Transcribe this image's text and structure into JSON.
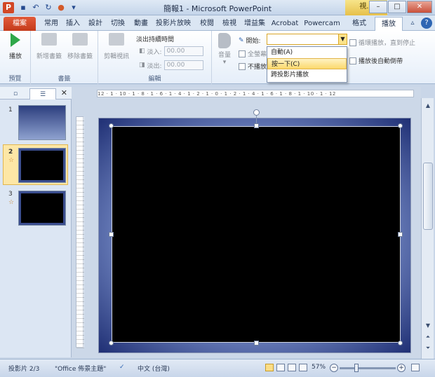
{
  "app": {
    "title": "簡報1 - Microsoft PowerPoint",
    "context_tab_group": "視...",
    "quick_access": [
      "save-icon",
      "undo-icon",
      "redo-icon",
      "record-icon",
      "customize-icon"
    ]
  },
  "tabs": [
    "檔案",
    "常用",
    "插入",
    "設計",
    "切換",
    "動畫",
    "投影片放映",
    "校閱",
    "檢視",
    "增益集",
    "Acrobat",
    "Powercam",
    "格式",
    "播放"
  ],
  "active_tab": "播放",
  "ribbon": {
    "preview": {
      "label": "預覽",
      "play": "播放"
    },
    "bookmarks": {
      "label": "書籤",
      "add": "新增書籤",
      "remove": "移除書籤"
    },
    "editing": {
      "label": "編輯",
      "trim": "剪輯視訊",
      "fade_duration": "淡出持續時間",
      "fade_in_label": "淡入:",
      "fade_in_value": "00.00",
      "fade_out_label": "淡出:",
      "fade_out_value": "00.00"
    },
    "video_options": {
      "volume": "音量",
      "start_label": "開始:",
      "start_value": "",
      "fullscreen": "全螢幕",
      "hide": "不播放時隱藏",
      "loop": "循環播放，直到停止",
      "rewind": "播放後自動倒帶"
    }
  },
  "start_menu": {
    "items": [
      "自動(A)",
      "按一下(C)",
      "跨投影片播放"
    ],
    "selected_index": 1
  },
  "slides_pane": {
    "slides": [
      {
        "number": "1",
        "star": ""
      },
      {
        "number": "2",
        "star": "☆"
      },
      {
        "number": "3",
        "star": "☆"
      }
    ],
    "selected": 2
  },
  "ruler": {
    "horizontal": "12 · 1 · 10 · 1 · 8 · 1 · 6 · 1 · 4 · 1 · 2 · 1 · 0 · 1 · 2 · 1 · 4 · 1 · 6 · 1 · 8 · 1 · 10 · 1 · 12"
  },
  "status": {
    "slide_info": "投影片 2/3",
    "theme": "\"Office 佈景主題\"",
    "language": "中文 (台灣)",
    "zoom": "57%"
  }
}
